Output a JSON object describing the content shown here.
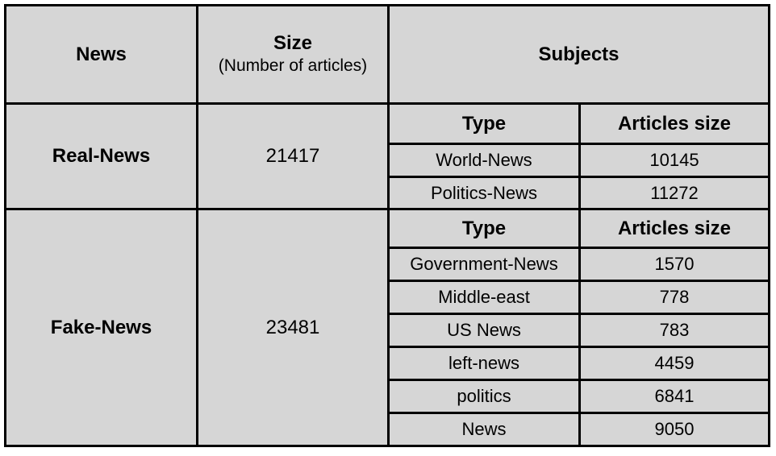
{
  "table": {
    "headers": {
      "news": "News",
      "size_title": "Size",
      "size_subtitle": "(Number of articles)",
      "subjects": "Subjects"
    },
    "groups": [
      {
        "label": "Real-News",
        "size": "21417",
        "subheaders": {
          "type": "Type",
          "articles": "Articles size"
        },
        "rows": [
          {
            "type": "World-News",
            "articles": "10145"
          },
          {
            "type": "Politics-News",
            "articles": "11272"
          }
        ]
      },
      {
        "label": "Fake-News",
        "size": "23481",
        "subheaders": {
          "type": "Type",
          "articles": "Articles size"
        },
        "rows": [
          {
            "type": "Government-News",
            "articles": "1570"
          },
          {
            "type": "Middle-east",
            "articles": "778"
          },
          {
            "type": "US News",
            "articles": "783"
          },
          {
            "type": "left-news",
            "articles": "4459"
          },
          {
            "type": "politics",
            "articles": "6841"
          },
          {
            "type": "News",
            "articles": "9050"
          }
        ]
      }
    ]
  }
}
